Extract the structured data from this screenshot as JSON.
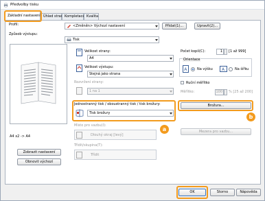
{
  "window": {
    "title": "Předvolby tisku"
  },
  "tabs": [
    {
      "label": "Základní nastavení"
    },
    {
      "label": "Úhled strany"
    },
    {
      "label": "Kompletace"
    },
    {
      "label": "Kvalita"
    }
  ],
  "profile": {
    "label": "Profil:",
    "value": "<Změněn> Výchozí nastavení",
    "add_button": "Přidat(1)...",
    "edit_button": "Upravit(2)..."
  },
  "output_method": {
    "label": "Způsob výstupu:",
    "value": "Tisk"
  },
  "preview": {
    "caption": "A4 x2 -> A4"
  },
  "left_buttons": {
    "show_settings": "Zobrazit nastavení",
    "restore_defaults": "Obnovit výchozí"
  },
  "page_size": {
    "label": "Velikost strany:",
    "value": "A4"
  },
  "output_size": {
    "label": "Velikost výstupu:",
    "value": "Stejná jako strana"
  },
  "page_layout": {
    "label": "Rozvržení strany:",
    "value": "1 na 1"
  },
  "duplex": {
    "label": "Jednostranný tisk / oboustranný tisk / tisk brožury:",
    "value": "Tisk brožury"
  },
  "binding_location": {
    "label": "Místo pro vazbu(I):",
    "value": "Dlouhý okraj [levý]"
  },
  "stapling": {
    "label": "Třídit/skupina(T):",
    "value": "Třídit"
  },
  "copies": {
    "label": "Počet kopií(C):",
    "value": "1",
    "range": "[1 až 999]"
  },
  "orientation": {
    "label": "Orientace",
    "portrait": "Na výšku",
    "landscape": "Na šířku"
  },
  "manual_scaling": {
    "label": "Ruční měřítko",
    "scale_label": "Měřítko:",
    "scale_value": "100",
    "scale_range": "% [25 až 200]"
  },
  "booklet_button": "Brožura...",
  "gutter_button": "Mezera pro vazbu...",
  "badges": {
    "a": "a",
    "b": "b"
  },
  "footer": {
    "ok": "OK",
    "cancel": "Storno",
    "help": "Nápověda"
  },
  "colors": {
    "highlight": "#f39b1d",
    "accent": "#1c5fc4"
  }
}
